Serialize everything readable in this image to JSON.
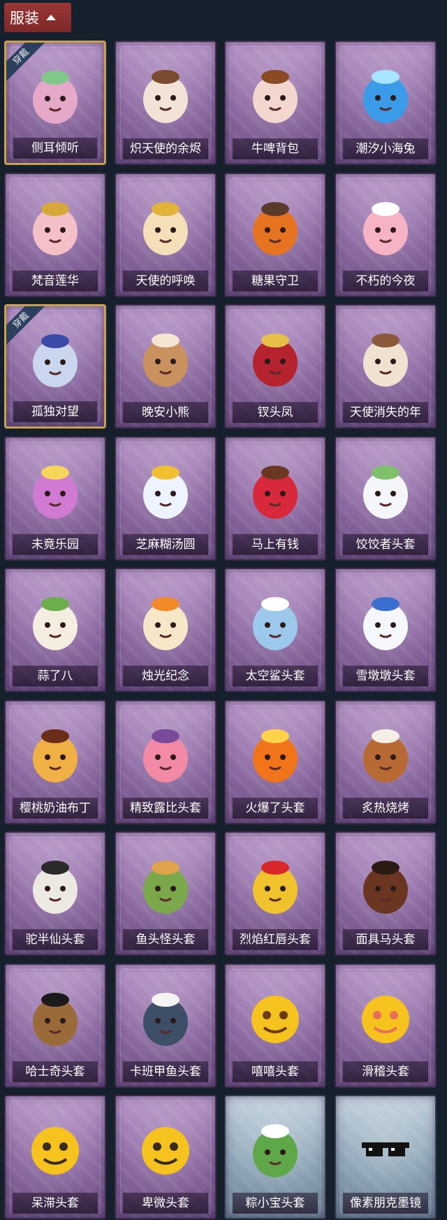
{
  "header": {
    "label": "服装",
    "icon": "chevron-up-icon"
  },
  "badge_label": "穿戴",
  "items": [
    {
      "name": "侧耳倾听",
      "worn": true,
      "theme": "purple",
      "icon": "lotus-wreath-icon",
      "color": "#e6a8c8",
      "accent": "#7fc88a"
    },
    {
      "name": "炽天使的余烬",
      "worn": false,
      "theme": "purple",
      "icon": "angel-girl-icon",
      "color": "#f1e4d6",
      "accent": "#7a4b2e"
    },
    {
      "name": "牛啤背包",
      "worn": false,
      "theme": "purple",
      "icon": "cow-barrel-icon",
      "color": "#f3d7cf",
      "accent": "#8a4a24"
    },
    {
      "name": "潮汐小海兔",
      "worn": false,
      "theme": "purple",
      "icon": "blue-seabunny-icon",
      "color": "#3a9ce8",
      "accent": "#a7e5ff"
    },
    {
      "name": "梵音莲华",
      "worn": false,
      "theme": "purple",
      "icon": "lotus-girl-icon",
      "color": "#f4c0c8",
      "accent": "#d6a83a"
    },
    {
      "name": "天使的呼唤",
      "worn": false,
      "theme": "purple",
      "icon": "angel-boy-icon",
      "color": "#f4dfb8",
      "accent": "#e2b33a"
    },
    {
      "name": "糖果守卫",
      "worn": false,
      "theme": "purple",
      "icon": "pumpkin-scarecrow-icon",
      "color": "#e5731f",
      "accent": "#5a3a2a"
    },
    {
      "name": "不朽的今夜",
      "worn": false,
      "theme": "purple",
      "icon": "pink-fox-icon",
      "color": "#f6b3c4",
      "accent": "#ffffff"
    },
    {
      "name": "孤独对望",
      "worn": true,
      "theme": "purple",
      "icon": "silver-hair-girl-icon",
      "color": "#c9d6ee",
      "accent": "#3b4aa8"
    },
    {
      "name": "晚安小熊",
      "worn": false,
      "theme": "purple",
      "icon": "teddy-bear-icon",
      "color": "#c8915e",
      "accent": "#f4e6d2"
    },
    {
      "name": "钗头凤",
      "worn": false,
      "theme": "purple",
      "icon": "phoenix-crown-girl-icon",
      "color": "#b4232e",
      "accent": "#e7c04a"
    },
    {
      "name": "天使消失的年",
      "worn": false,
      "theme": "purple",
      "icon": "halo-girl-icon",
      "color": "#f0e2d0",
      "accent": "#8a5a3a"
    },
    {
      "name": "未竟乐园",
      "worn": false,
      "theme": "purple",
      "icon": "magical-girl-icon",
      "color": "#d07ad2",
      "accent": "#f5d55a"
    },
    {
      "name": "芝麻糊汤圆",
      "worn": false,
      "theme": "purple",
      "icon": "rice-ball-icon",
      "color": "#eef4ff",
      "accent": "#f0c030"
    },
    {
      "name": "马上有钱",
      "worn": false,
      "theme": "purple",
      "icon": "red-horse-icon",
      "color": "#d8283c",
      "accent": "#6a3820"
    },
    {
      "name": "饺饺者头套",
      "worn": false,
      "theme": "purple",
      "icon": "dumpling-head-icon",
      "color": "#f4f6fa",
      "accent": "#7fc06a"
    },
    {
      "name": "蒜了八",
      "worn": false,
      "theme": "purple",
      "icon": "garlic-head-icon",
      "color": "#f4ede0",
      "accent": "#6cae4a"
    },
    {
      "name": "烛光纪念",
      "worn": false,
      "theme": "purple",
      "icon": "candle-head-icon",
      "color": "#f6e7c8",
      "accent": "#f28a2a"
    },
    {
      "name": "太空鲨头套",
      "worn": false,
      "theme": "purple",
      "icon": "shark-head-icon",
      "color": "#9cc8ec",
      "accent": "#ffffff"
    },
    {
      "name": "雪墩墩头套",
      "worn": false,
      "theme": "purple",
      "icon": "snowman-head-icon",
      "color": "#f4f7fb",
      "accent": "#3a6fd0"
    },
    {
      "name": "樱桃奶油布丁",
      "worn": false,
      "theme": "purple",
      "icon": "pudding-head-icon",
      "color": "#f0b044",
      "accent": "#6a2e18"
    },
    {
      "name": "精致露比头套",
      "worn": false,
      "theme": "purple",
      "icon": "pink-beaver-head-icon",
      "color": "#f28aa6",
      "accent": "#7a4a9a"
    },
    {
      "name": "火爆了头套",
      "worn": false,
      "theme": "purple",
      "icon": "fire-head-icon",
      "color": "#f2741a",
      "accent": "#ffd24a"
    },
    {
      "name": "炙热烧烤",
      "worn": false,
      "theme": "purple",
      "icon": "meat-bone-head-icon",
      "color": "#b86a34",
      "accent": "#f4efe6"
    },
    {
      "name": "驼半仙头套",
      "worn": false,
      "theme": "purple",
      "icon": "polar-bear-head-icon",
      "color": "#ece8e2",
      "accent": "#2a2a2a"
    },
    {
      "name": "鱼头怪头套",
      "worn": false,
      "theme": "purple",
      "icon": "fish-head-icon",
      "color": "#7aa84a",
      "accent": "#e0a24a"
    },
    {
      "name": "烈焰红唇头套",
      "worn": false,
      "theme": "purple",
      "icon": "pikachu-head-icon",
      "color": "#f0c22e",
      "accent": "#d8282a"
    },
    {
      "name": "面具马头套",
      "worn": false,
      "theme": "purple",
      "icon": "horse-mask-icon",
      "color": "#6a3622",
      "accent": "#2a1a14"
    },
    {
      "name": "哈士奇头套",
      "worn": false,
      "theme": "purple",
      "icon": "husky-head-icon",
      "color": "#9a6a3a",
      "accent": "#1a1a1a"
    },
    {
      "name": "卡班甲鱼头套",
      "worn": false,
      "theme": "purple",
      "icon": "turtle-head-icon",
      "color": "#3d4f66",
      "accent": "#f4f4f4"
    },
    {
      "name": "嘻嘻头套",
      "worn": false,
      "theme": "purple",
      "icon": "grin-emoji-icon",
      "color": "#f6c21e",
      "accent": "#6a3a10"
    },
    {
      "name": "滑稽头套",
      "worn": false,
      "theme": "purple",
      "icon": "smirk-emoji-icon",
      "color": "#f6c21e",
      "accent": "#e8705a"
    },
    {
      "name": "呆滞头套",
      "worn": false,
      "theme": "purple",
      "icon": "stare-emoji-icon",
      "color": "#f6c21e",
      "accent": "#3a2a1a"
    },
    {
      "name": "卑微头套",
      "worn": false,
      "theme": "purple",
      "icon": "humble-emoji-icon",
      "color": "#f6c21e",
      "accent": "#3a2a1a"
    },
    {
      "name": "粽小宝头套",
      "worn": false,
      "theme": "blue",
      "icon": "zongzi-head-icon",
      "color": "#5ea84a",
      "accent": "#ffffff"
    },
    {
      "name": "像素朋克墨镜",
      "worn": false,
      "theme": "blue",
      "icon": "pixel-sunglasses-icon",
      "color": "#111111",
      "accent": "#ffffff"
    }
  ]
}
